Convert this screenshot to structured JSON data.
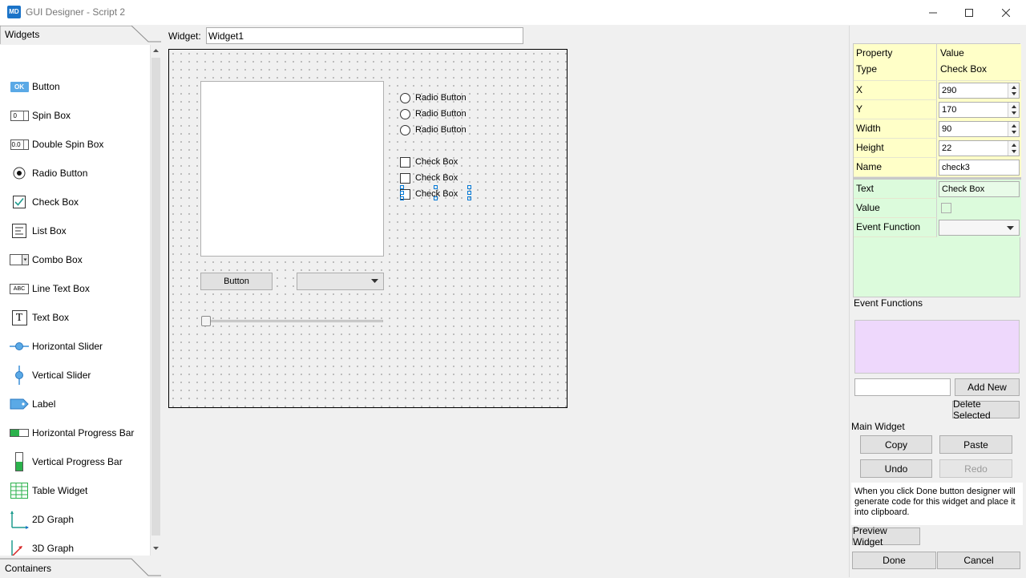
{
  "window": {
    "icon_text": "MD",
    "title": "GUI Designer - Script 2"
  },
  "left_panel": {
    "tab_widgets": "Widgets",
    "tab_containers": "Containers",
    "items": [
      {
        "label": "Button",
        "icon": "button-icon"
      },
      {
        "label": "Spin Box",
        "icon": "spin-box-icon"
      },
      {
        "label": "Double Spin Box",
        "icon": "double-spin-box-icon"
      },
      {
        "label": "Radio Button",
        "icon": "radio-button-icon"
      },
      {
        "label": "Check Box",
        "icon": "check-box-icon"
      },
      {
        "label": "List Box",
        "icon": "list-box-icon"
      },
      {
        "label": "Combo Box",
        "icon": "combo-box-icon"
      },
      {
        "label": "Line Text Box",
        "icon": "line-text-box-icon"
      },
      {
        "label": "Text Box",
        "icon": "text-box-icon"
      },
      {
        "label": "Horizontal Slider",
        "icon": "horizontal-slider-icon"
      },
      {
        "label": "Vertical Slider",
        "icon": "vertical-slider-icon"
      },
      {
        "label": "Label",
        "icon": "label-icon"
      },
      {
        "label": "Horizontal Progress Bar",
        "icon": "horizontal-progress-bar-icon"
      },
      {
        "label": "Vertical Progress Bar",
        "icon": "vertical-progress-bar-icon"
      },
      {
        "label": "Table Widget",
        "icon": "table-widget-icon"
      },
      {
        "label": "2D Graph",
        "icon": "2d-graph-icon"
      },
      {
        "label": "3D Graph",
        "icon": "3d-graph-icon"
      }
    ],
    "icon_texts": {
      "button": "OK",
      "spin": "0",
      "double_spin": "0.0",
      "line_text": "ABC",
      "text_box": "T"
    }
  },
  "widget_name": {
    "label": "Widget:",
    "value": "Widget1"
  },
  "canvas": {
    "radio_labels": [
      "Radio Button",
      "Radio Button",
      "Radio Button"
    ],
    "check_labels": [
      "Check Box",
      "Check Box",
      "Check Box"
    ],
    "button_label": "Button"
  },
  "properties": {
    "header_property": "Property",
    "header_value": "Value",
    "type_label": "Type",
    "type_value": "Check Box",
    "x_label": "X",
    "x_value": "290",
    "y_label": "Y",
    "y_value": "170",
    "width_label": "Width",
    "width_value": "90",
    "height_label": "Height",
    "height_value": "22",
    "name_label": "Name",
    "name_value": "check3",
    "text_label": "Text",
    "text_value": "Check Box",
    "value_label": "Value",
    "value_checked": false,
    "event_label": "Event Function",
    "event_value": ""
  },
  "event_functions": {
    "title": "Event Functions",
    "input_value": "",
    "add_new": "Add New",
    "delete_selected": "Delete Selected"
  },
  "main_widget": {
    "title": "Main Widget",
    "copy": "Copy",
    "paste": "Paste",
    "undo": "Undo",
    "redo": "Redo",
    "hint": "When you click Done button designer will generate code for this widget and place it into clipboard."
  },
  "footer": {
    "preview": "Preview Widget",
    "done": "Done",
    "cancel": "Cancel"
  },
  "colors": {
    "yellow_row": "#ffffc8",
    "green_row": "#dcfbdc",
    "event_box": "#eed8fc",
    "accent": "#1a73c8"
  }
}
